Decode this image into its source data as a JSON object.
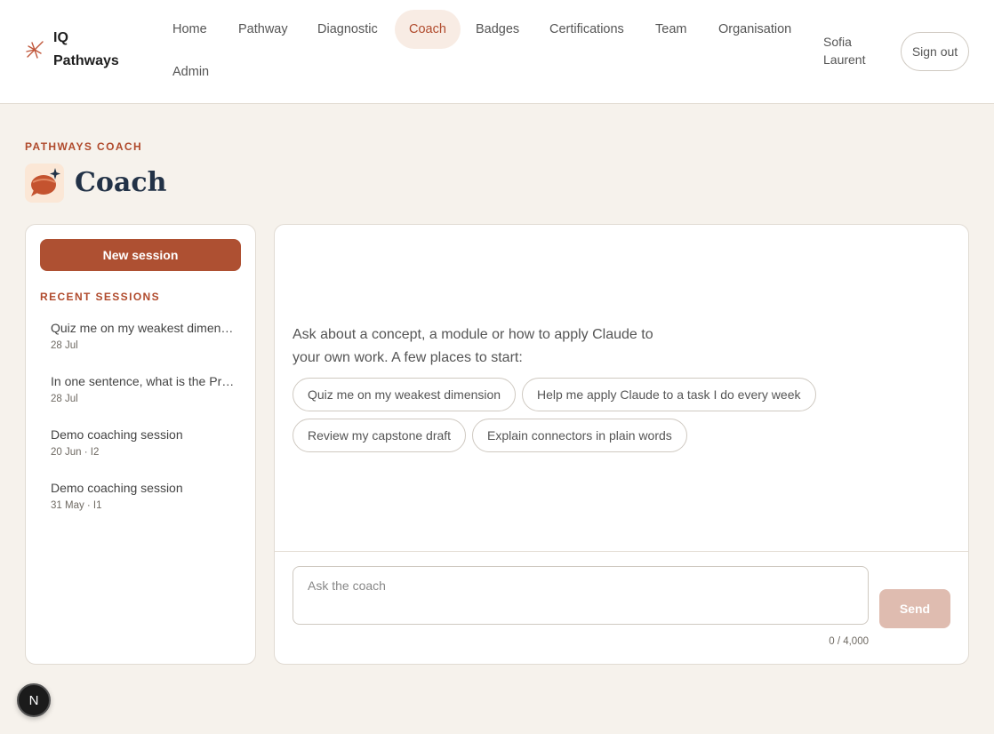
{
  "brand": {
    "name": "IQ Pathways",
    "icon": "sparkle-burst-icon"
  },
  "nav": {
    "items": [
      {
        "label": "Home"
      },
      {
        "label": "Pathway"
      },
      {
        "label": "Diagnostic"
      },
      {
        "label": "Coach",
        "active": true
      },
      {
        "label": "Badges"
      },
      {
        "label": "Certifications"
      },
      {
        "label": "Team"
      },
      {
        "label": "Organisation"
      },
      {
        "label": "Admin"
      }
    ]
  },
  "user": {
    "name": "Sofia Laurent",
    "signout_label": "Sign out"
  },
  "page": {
    "eyebrow": "PATHWAYS COACH",
    "title": "Coach",
    "icon": "coach-speech-bubble-icon"
  },
  "sidebar": {
    "new_session_label": "New session",
    "recent_label": "RECENT SESSIONS",
    "sessions": [
      {
        "title": "Quiz me on my weakest dimen…",
        "meta": "28 Jul"
      },
      {
        "title": "In one sentence, what is the Pr…",
        "meta": "28 Jul"
      },
      {
        "title": "Demo coaching session",
        "meta": "20 Jun · I2"
      },
      {
        "title": "Demo coaching session",
        "meta": "31 May · I1"
      }
    ]
  },
  "main": {
    "intro": "Ask about a concept, a module or how to apply Claude to your own work. A few places to start:",
    "suggestions": [
      "Quiz me on my weakest dimension",
      "Help me apply Claude to a task I do every week",
      "Review my capstone draft",
      "Explain connectors in plain words"
    ],
    "input": {
      "placeholder": "Ask the coach",
      "value": ""
    },
    "counter": "0 / 4,000",
    "send_label": "Send"
  },
  "fab": {
    "label": "N"
  },
  "colors": {
    "accent": "#ae5032",
    "background": "#f6f2ec",
    "title": "#223247",
    "send_disabled": "#dfbcb0"
  }
}
